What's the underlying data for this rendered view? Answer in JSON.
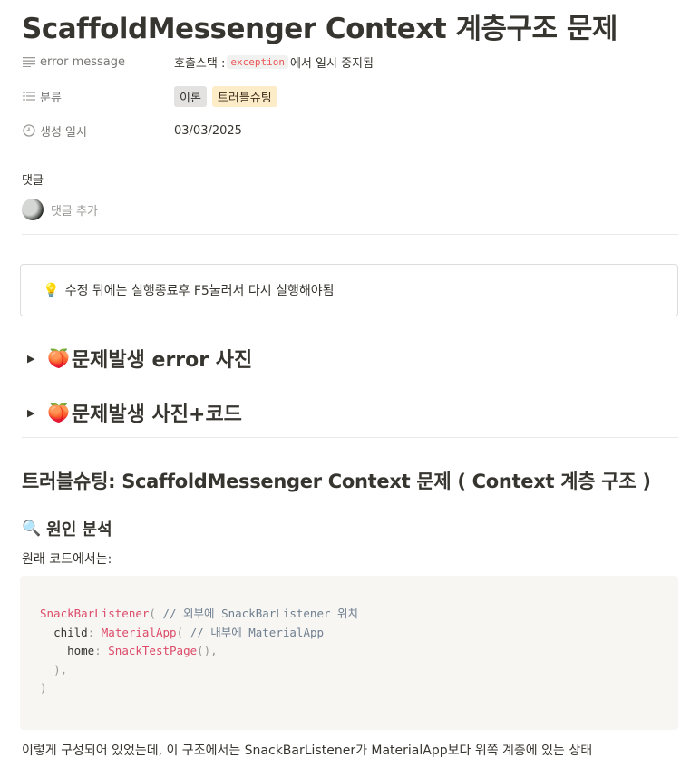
{
  "title": "ScaffoldMessenger Context 계층구조 문제",
  "properties": {
    "error": {
      "label": "error message",
      "prefix": "호출스택 :",
      "code": "exception",
      "suffix": "에서 일시 중지됨"
    },
    "category": {
      "label": "분류",
      "tags": [
        "이론",
        "트러블슈팅"
      ]
    },
    "created": {
      "label": "생성 일시",
      "value": "03/03/2025"
    }
  },
  "comments": {
    "title": "댓글",
    "placeholder": "댓글 추가"
  },
  "callout": {
    "icon": "💡",
    "text": "수정 뒤에는 실행종료후 F5눌러서 다시 실행해야됨"
  },
  "toggles": [
    {
      "emoji": "🍑",
      "title": "문제발생 error 사진"
    },
    {
      "emoji": "🍑",
      "title": "문제발생 사진+코드"
    }
  ],
  "heading2": "트러블슈팅: ScaffoldMessenger Context 문제 ( Context 계층 구조 )",
  "heading3": {
    "emoji": "🔍",
    "text": "원인 분석"
  },
  "intro": "원래 코드에서는:",
  "code": {
    "l1_cls": "SnackBarListener",
    "l1_pun": "( ",
    "l1_com1": "// 외부에 ",
    "l1_com2": "SnackBarListener",
    "l1_com3": " 위치",
    "l2_key": "child",
    "l2_pun": ": ",
    "l2_cls": "MaterialApp",
    "l2_pun2": "( ",
    "l2_com1": "// 내부에 ",
    "l2_com2": "MaterialApp",
    "l3_key": "home",
    "l3_pun": ": ",
    "l3_cls": "SnackTestPage",
    "l3_pun2": "(),",
    "l4": "),",
    "l5": ")"
  },
  "after_text": "이렇게 구성되어 있었는데, 이 구조에서는 SnackBarListener가 MaterialApp보다 위쪽 계층에 있는 상태"
}
